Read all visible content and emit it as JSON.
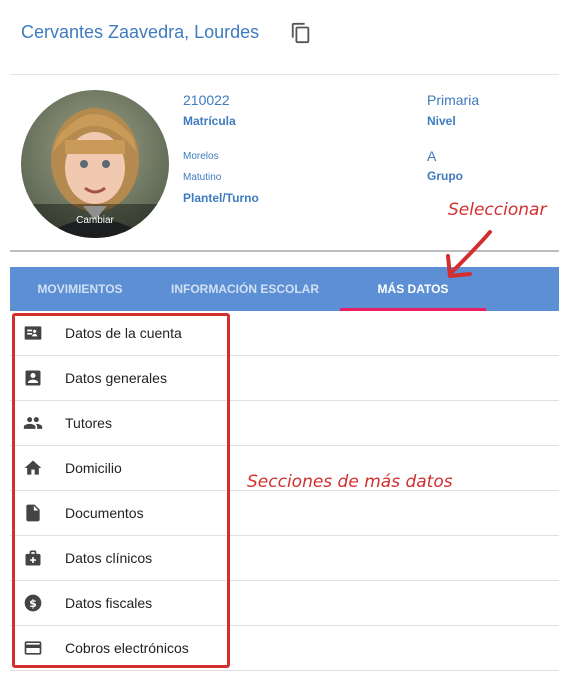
{
  "header": {
    "student_name": "Cervantes Zaavedra, Lourdes",
    "copy_icon": "copy-icon"
  },
  "avatar": {
    "change_label": "Cambiar"
  },
  "student": {
    "enrollment_value": "210022",
    "enrollment_label": "Matrícula",
    "campus_value": "Morelos",
    "shift_value": "Matutino",
    "campus_shift_label": "Plantel/Turno",
    "level_value": "Primaria",
    "level_label": "Nivel",
    "group_value": "A",
    "group_label": "Grupo"
  },
  "tabs": [
    {
      "label": "MOVIMIENTOS",
      "active": false
    },
    {
      "label": "INFORMACIÓN ESCOLAR",
      "active": false
    },
    {
      "label": "MÁS DATOS",
      "active": true
    }
  ],
  "colors": {
    "primary": "#5c8fd3",
    "text_blue": "#3e7bbf",
    "tab_indicator": "#e91e63",
    "annotation": "#d32f2f"
  },
  "menu": [
    {
      "label": "Datos de la cuenta",
      "icon": "account-card-icon"
    },
    {
      "label": "Datos generales",
      "icon": "person-box-icon"
    },
    {
      "label": "Tutores",
      "icon": "people-icon"
    },
    {
      "label": "Domicilio",
      "icon": "home-icon"
    },
    {
      "label": "Documentos",
      "icon": "document-icon"
    },
    {
      "label": "Datos clínicos",
      "icon": "medical-bag-icon"
    },
    {
      "label": "Datos fiscales",
      "icon": "dollar-circle-icon"
    },
    {
      "label": "Cobros electrónicos",
      "icon": "credit-card-icon"
    }
  ],
  "annotations": {
    "select_label": "Seleccionar",
    "sections_label": "Secciones de más datos"
  }
}
